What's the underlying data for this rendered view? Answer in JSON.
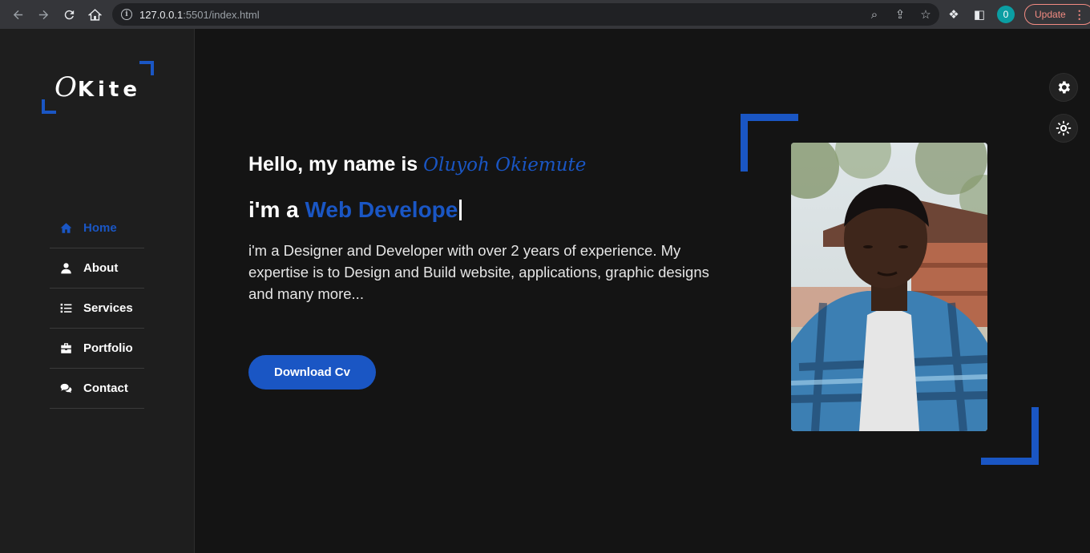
{
  "browser": {
    "url_host": "127.0.0.1",
    "url_path": ":5501/index.html",
    "profile_initial": "0",
    "update_label": "Update"
  },
  "sidebar": {
    "logo_first": "O",
    "logo_rest": "Kite",
    "items": [
      {
        "label": "Home",
        "icon": "home-icon"
      },
      {
        "label": "About",
        "icon": "user-icon"
      },
      {
        "label": "Services",
        "icon": "list-icon"
      },
      {
        "label": "Portfolio",
        "icon": "briefcase-icon"
      },
      {
        "label": "Contact",
        "icon": "chat-icon"
      }
    ]
  },
  "hero": {
    "greeting": "Hello, my name is ",
    "name": "Oluyoh Okiemute",
    "role_prefix": "i'm a ",
    "role": "Web Develope",
    "description": "i'm a Designer and Developer with over 2 years of experience. My expertise is to Design and Build website, applications, graphic designs and many more...",
    "cta": "Download Cv"
  },
  "colors": {
    "accent": "#1a56c4",
    "background": "#141414",
    "sidebar": "#1e1e1e"
  }
}
